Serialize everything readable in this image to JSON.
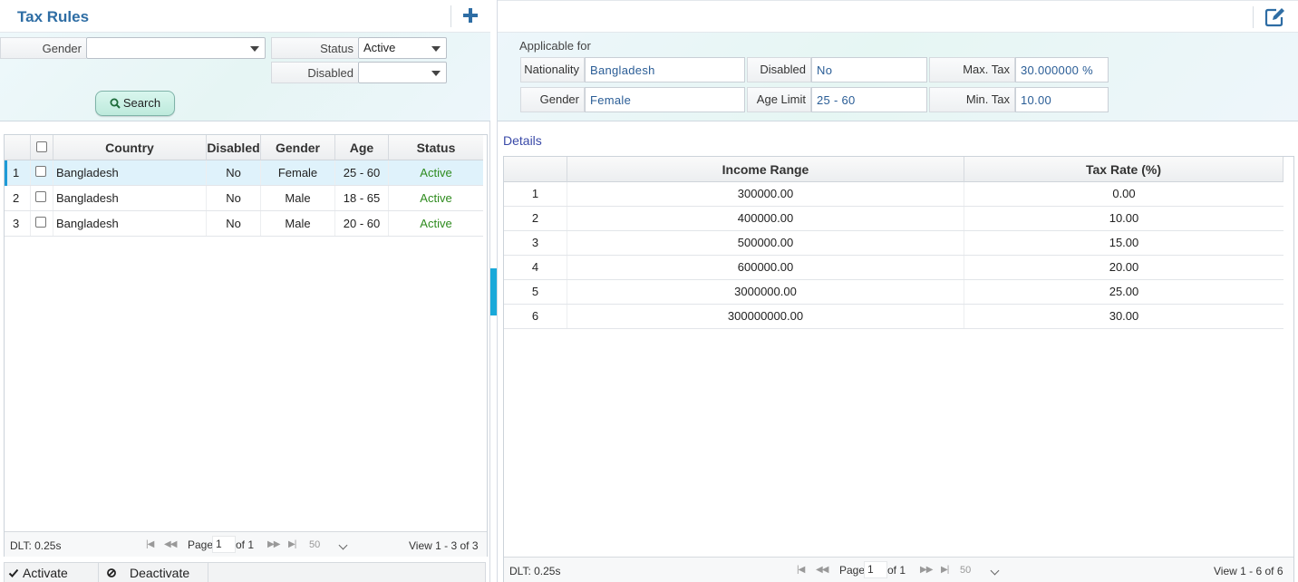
{
  "left": {
    "title": "Tax Rules",
    "filters": {
      "gender_label": "Gender",
      "gender_value": "",
      "status_label": "Status",
      "status_value": "Active",
      "disabled_label": "Disabled",
      "disabled_value": ""
    },
    "search_label": "Search",
    "grid": {
      "headers": {
        "country": "Country",
        "disabled": "Disabled",
        "gender": "Gender",
        "age": "Age",
        "status": "Status"
      },
      "rows": [
        {
          "num": "1",
          "country": "Bangladesh",
          "disabled": "No",
          "gender": "Female",
          "age": "25 - 60",
          "status": "Active"
        },
        {
          "num": "2",
          "country": "Bangladesh",
          "disabled": "No",
          "gender": "Male",
          "age": "18 - 65",
          "status": "Active"
        },
        {
          "num": "3",
          "country": "Bangladesh",
          "disabled": "No",
          "gender": "Male",
          "age": "20 - 60",
          "status": "Active"
        }
      ]
    },
    "pager": {
      "dlt": "DLT: 0.25s",
      "page_label": "Page",
      "page": "1",
      "of": "of 1",
      "rows": "50",
      "view": "View 1 - 3 of 3"
    },
    "actions": {
      "activate": "Activate",
      "deactivate": "Deactivate"
    }
  },
  "right": {
    "applicable_for": "Applicable for",
    "fields": {
      "nationality_label": "Nationality",
      "nationality_value": "Bangladesh",
      "disabled_label": "Disabled",
      "disabled_value": "No",
      "max_tax_label": "Max. Tax",
      "max_tax_value": "30.000000 %",
      "gender_label": "Gender",
      "gender_value": "Female",
      "age_limit_label": "Age Limit",
      "age_limit_value": "25 - 60",
      "min_tax_label": "Min. Tax",
      "min_tax_value": "10.00"
    },
    "details_title": "Details",
    "grid": {
      "headers": {
        "income_range": "Income Range",
        "tax_rate": "Tax Rate (%)"
      },
      "rows": [
        {
          "num": "1",
          "income": "300000.00",
          "rate": "0.00"
        },
        {
          "num": "2",
          "income": "400000.00",
          "rate": "10.00"
        },
        {
          "num": "3",
          "income": "500000.00",
          "rate": "15.00"
        },
        {
          "num": "4",
          "income": "600000.00",
          "rate": "20.00"
        },
        {
          "num": "5",
          "income": "3000000.00",
          "rate": "25.00"
        },
        {
          "num": "6",
          "income": "300000000.00",
          "rate": "30.00"
        }
      ]
    },
    "pager": {
      "dlt": "DLT: 0.25s",
      "page_label": "Page",
      "page": "1",
      "of": "of 1",
      "rows": "50",
      "view": "View 1 - 6 of 6"
    }
  },
  "colors": {
    "accent": "#2e6da4",
    "active": "#2e8b1e",
    "selected_row": "#dff2fb",
    "splitter": "#1aa9d9"
  }
}
